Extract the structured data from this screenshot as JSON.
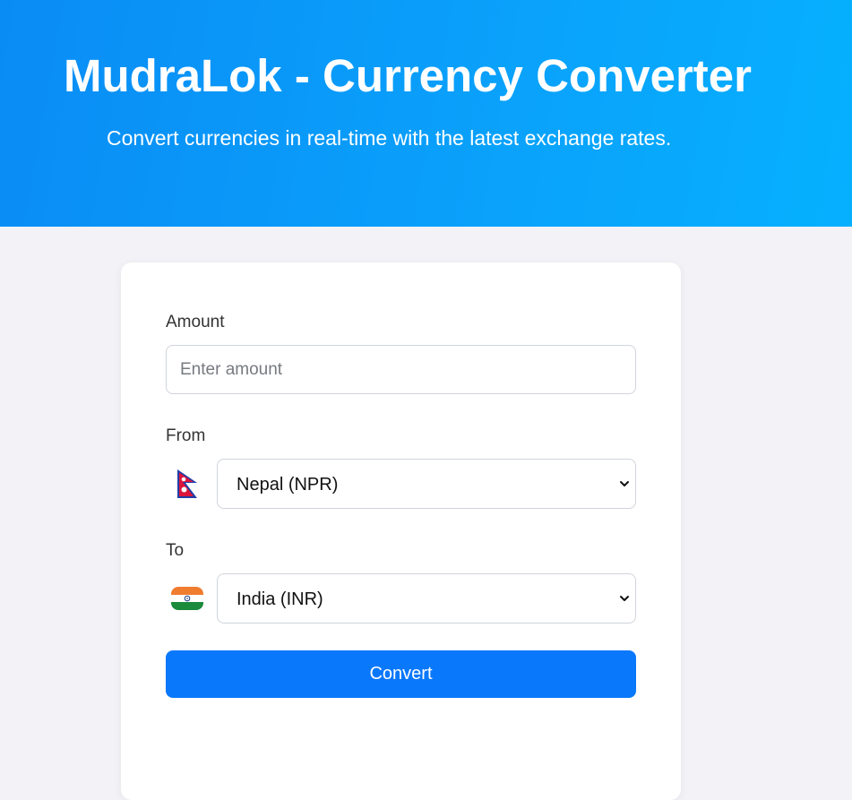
{
  "header": {
    "title": "MudraLok - Currency Converter",
    "subtitle": "Convert currencies in real-time with the latest exchange rates."
  },
  "form": {
    "amount_label": "Amount",
    "amount_placeholder": "Enter amount",
    "amount_value": "",
    "from_label": "From",
    "from_selected": "Nepal (NPR)",
    "from_flag_icon": "nepal-flag-icon",
    "to_label": "To",
    "to_selected": "India (INR)",
    "to_flag_icon": "india-flag-icon",
    "convert_label": "Convert"
  },
  "colors": {
    "header_gradient_start": "#0a8cf5",
    "header_gradient_end": "#06b0ff",
    "page_background": "#f2f2f7",
    "button_primary": "#0a78fb"
  }
}
